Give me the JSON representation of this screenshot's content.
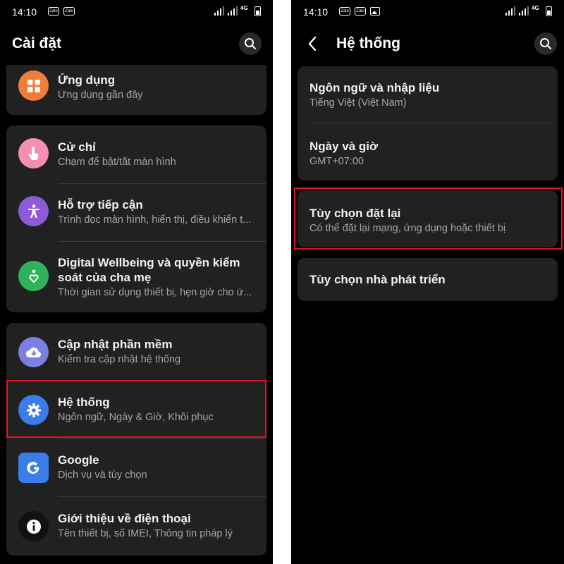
{
  "status": {
    "time": "14:10",
    "zalo": "Zalo",
    "network": "4G"
  },
  "left": {
    "title": "Cài đặt",
    "items": [
      {
        "title": "Ứng dụng",
        "sub": "Ứng dụng gần đây",
        "color": "#f07d3a",
        "icon": "apps-grid-icon"
      },
      {
        "title": "Cử chỉ",
        "sub": "Chạm để bật/tắt màn hình",
        "color": "#f48fb1",
        "icon": "touch-hand-icon"
      },
      {
        "title": "Hỗ trợ tiếp cận",
        "sub": "Trình đọc màn hình, hiển thị, điều khiển t...",
        "color": "#8e5bd8",
        "icon": "accessibility-icon"
      },
      {
        "title_line1": "Digital Wellbeing và quyền kiểm",
        "title_line2": "soát của cha mẹ",
        "sub": "Thời gian sử dụng thiết bị, hẹn giờ cho ứ...",
        "color": "#2fb35a",
        "icon": "wellbeing-heart-icon"
      },
      {
        "title": "Cập nhật phần mềm",
        "sub": "Kiểm tra cập nhật hệ thống",
        "color": "#7b7fe0",
        "icon": "cloud-download-icon"
      },
      {
        "title": "Hệ thống",
        "sub": "Ngôn ngữ, Ngày & Giờ, Khôi phục",
        "color": "#3a7de8",
        "icon": "gear-icon"
      },
      {
        "title": "Google",
        "sub": "Dịch vụ và tùy chọn",
        "color": "#3a7de8",
        "icon": "google-g-icon"
      },
      {
        "title": "Giới thiệu về điện thoại",
        "sub": "Tên thiết bị, số IMEI, Thông tin pháp lý",
        "color": "#111111",
        "icon": "info-icon"
      }
    ]
  },
  "right": {
    "title": "Hệ thống",
    "items": [
      {
        "title": "Ngôn ngữ và nhập liệu",
        "sub": "Tiếng Việt (Việt Nam)"
      },
      {
        "title": "Ngày và giờ",
        "sub": "GMT+07:00"
      },
      {
        "title": "Tùy chọn đặt lại",
        "sub": "Có thể đặt lại mạng, ứng dụng hoặc thiết bị"
      },
      {
        "title": "Tùy chọn nhà phát triển"
      }
    ]
  },
  "highlight_color": "#e0141e"
}
